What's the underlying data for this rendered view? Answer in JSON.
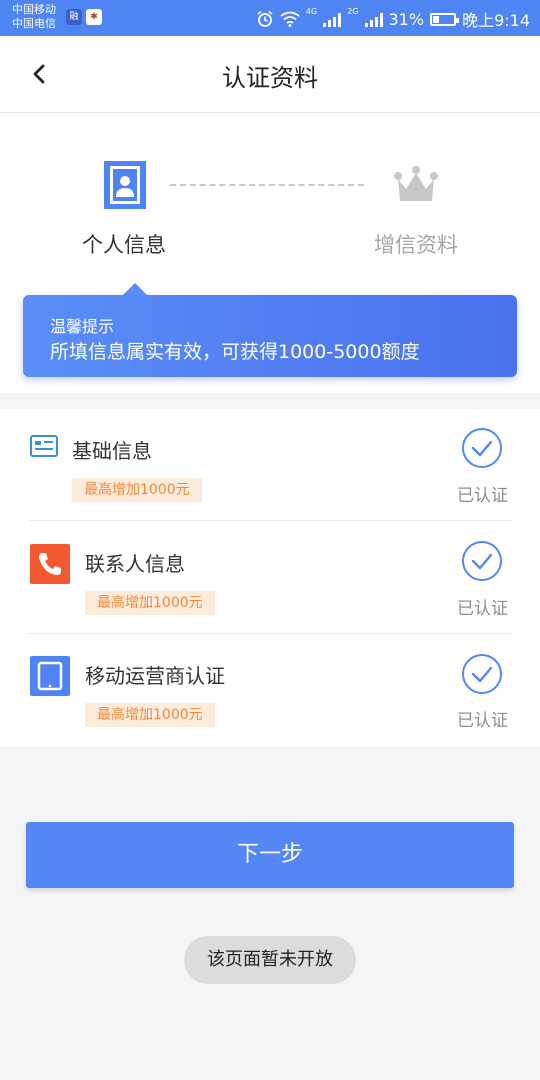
{
  "status_bar": {
    "carrier_1": "中国移动",
    "carrier_2": "中国电信",
    "app_icon_1": "融",
    "network_1": "4G",
    "network_2": "2G",
    "battery": "31%",
    "battery_level": 0.31,
    "time": "晚上9:14",
    "colors": {
      "background": "#4f84f3"
    }
  },
  "header": {
    "title": "认证资料",
    "back_icon": "chevron-left-icon"
  },
  "steps": {
    "items": [
      {
        "label": "个人信息",
        "icon": "person-id-icon",
        "active": true
      },
      {
        "label": "增信资料",
        "icon": "crown-icon",
        "active": false
      }
    ]
  },
  "tip": {
    "title": "温馨提示",
    "text": "所填信息属实有效，可获得1000-5000额度"
  },
  "auth_items": [
    {
      "name": "基础信息",
      "badge": "最高增加1000元",
      "status": "已认证",
      "icon": "id-card-icon"
    },
    {
      "name": "联系人信息",
      "badge": "最高增加1000元",
      "status": "已认证",
      "icon": "phone-icon"
    },
    {
      "name": "移动运营商认证",
      "badge": "最高增加1000元",
      "status": "已认证",
      "icon": "mobile-device-icon"
    }
  ],
  "next_button": {
    "label": "下一步"
  },
  "toast": {
    "text": "该页面暂未开放"
  },
  "colors": {
    "primary": "#5486f4",
    "badge_text": "#f28a3c",
    "badge_bg": "#fdecdc",
    "phone_icon": "#f3592e"
  }
}
